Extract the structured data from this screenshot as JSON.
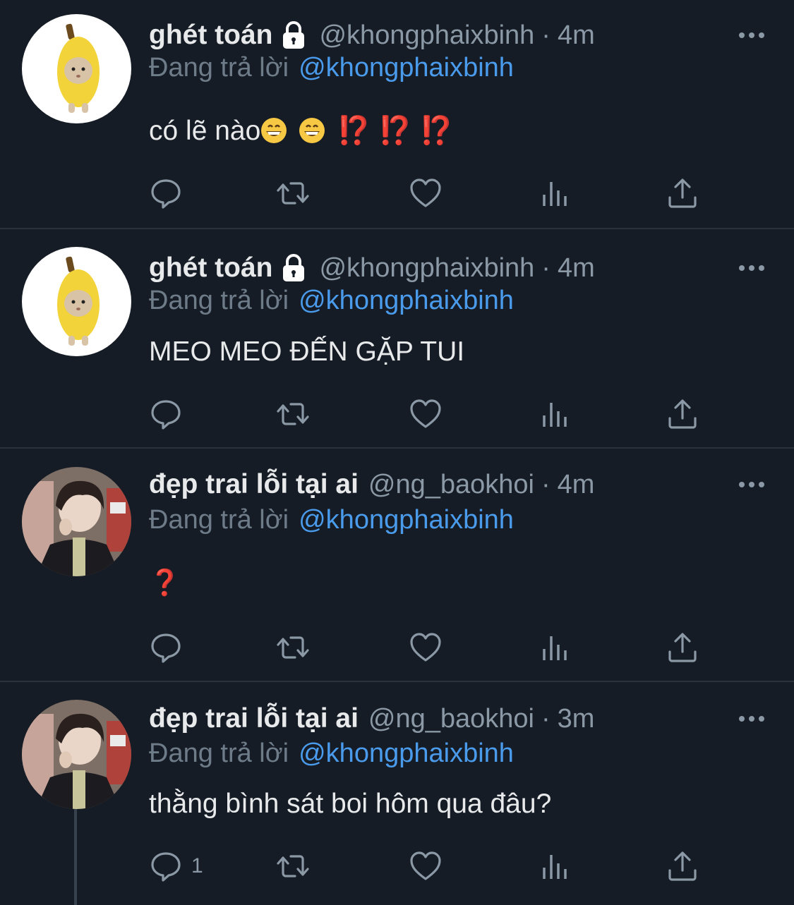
{
  "tweets": [
    {
      "display_name": "ghét toán",
      "locked": true,
      "handle": "@khongphaixbinh",
      "time": "4m",
      "reply_prefix": "Đang trả lời",
      "reply_to": "@khongphaixbinh",
      "text": "có lẽ nào",
      "emoji_after_text": [
        "grinning-face",
        "grinning-face",
        "interrobang",
        "interrobang",
        "interrobang"
      ],
      "interrobang": "⁉️",
      "reply_count": ""
    },
    {
      "display_name": "ghét toán",
      "locked": true,
      "handle": "@khongphaixbinh",
      "time": "4m",
      "reply_prefix": "Đang trả lời",
      "reply_to": "@khongphaixbinh",
      "text": "MEO MEO ĐẾN GẶP TUI",
      "reply_count": ""
    },
    {
      "display_name": "đẹp trai lỗi tại ai",
      "locked": false,
      "handle": "@ng_baokhoi",
      "time": "4m",
      "reply_prefix": "Đang trả lời",
      "reply_to": "@khongphaixbinh",
      "text": "❓",
      "reply_count": ""
    },
    {
      "display_name": "đẹp trai lỗi tại ai",
      "locked": false,
      "handle": "@ng_baokhoi",
      "time": "3m",
      "reply_prefix": "Đang trả lời",
      "reply_to": "@khongphaixbinh",
      "text": "thằng bình sát boi hôm qua đâu?",
      "reply_count": "1"
    }
  ],
  "separator": "·",
  "icons": {
    "more": "more-dots-icon",
    "reply": "reply-bubble-icon",
    "retweet": "retweet-icon",
    "like": "heart-icon",
    "views": "views-bars-icon",
    "share": "share-icon",
    "lock": "lock-icon"
  },
  "colors": {
    "background": "#151c25",
    "divider": "#2a323d",
    "text": "#e7e9ea",
    "muted": "#8b98a5",
    "link": "#4a9bec",
    "emoji_red": "#d23d2a"
  }
}
